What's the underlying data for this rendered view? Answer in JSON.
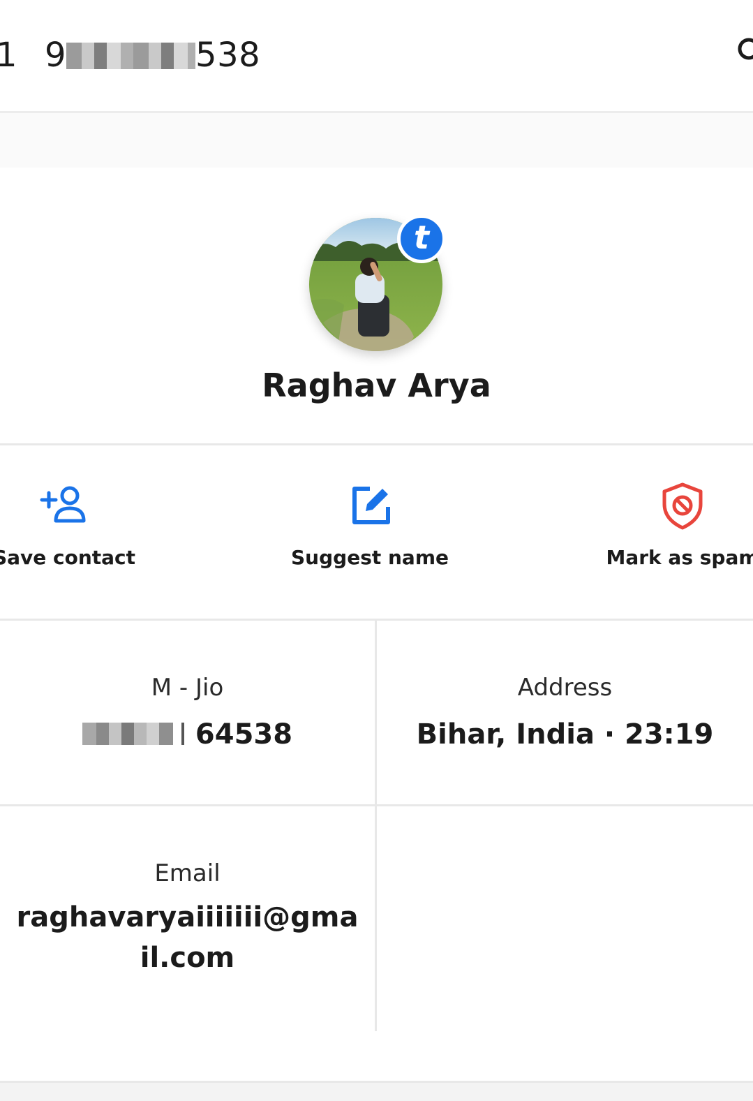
{
  "header": {
    "prefix": "1",
    "number_start": "9",
    "number_end": "538"
  },
  "profile": {
    "name": "Raghav Arya",
    "badge_letter": "t",
    "badge_color": "#1a73e8"
  },
  "actions": [
    {
      "label": "Save contact",
      "icon": "add-person-icon",
      "color": "#1a73e8"
    },
    {
      "label": "Suggest name",
      "icon": "edit-icon",
      "color": "#1a73e8"
    },
    {
      "label": "Mark as spam",
      "icon": "spam-shield-icon",
      "color": "#e8453c"
    }
  ],
  "info": {
    "carrier": {
      "title": "M - Jio",
      "value": "64538"
    },
    "address": {
      "title": "Address",
      "value": "Bihar, India · 23:19"
    },
    "email": {
      "title": "Email",
      "value": "raghavaryaiiiiiii@gmail.com"
    }
  }
}
